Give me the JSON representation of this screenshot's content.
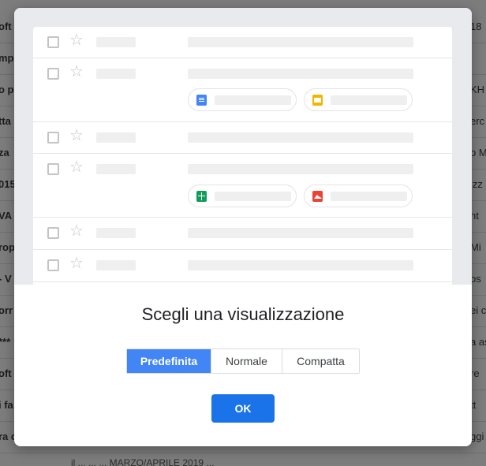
{
  "background": {
    "rows_left": [
      "oft",
      "mp",
      "o po",
      "tta",
      "za",
      "015",
      "VA",
      "rop",
      "- V",
      "orr",
      "***",
      "oft",
      "i fa",
      "ra c"
    ],
    "rows_right": [
      "18",
      "",
      "KH",
      "erc",
      "o M",
      "izz",
      "nt",
      "Mi",
      "os",
      "ei c",
      "a as",
      "re",
      "tt",
      "ggi"
    ],
    "bottom_text": "il  ...  ...  ...  MARZO/APRILE 2019  ..."
  },
  "modal": {
    "title": "Scegli una visualizzazione",
    "options": [
      {
        "label": "Predefinita",
        "active": true
      },
      {
        "label": "Normale",
        "active": false
      },
      {
        "label": "Compatta",
        "active": false
      }
    ],
    "ok_label": "OK",
    "preview": {
      "chip_icons": [
        "docs-icon",
        "slides-icon",
        "sheets-icon",
        "image-icon"
      ]
    }
  },
  "colors": {
    "primary": "#1a73e8",
    "segment_active": "#4285f4",
    "docs": "#4285f4",
    "slides": "#f4b400",
    "sheets": "#0f9d58",
    "image": "#ea4335"
  }
}
